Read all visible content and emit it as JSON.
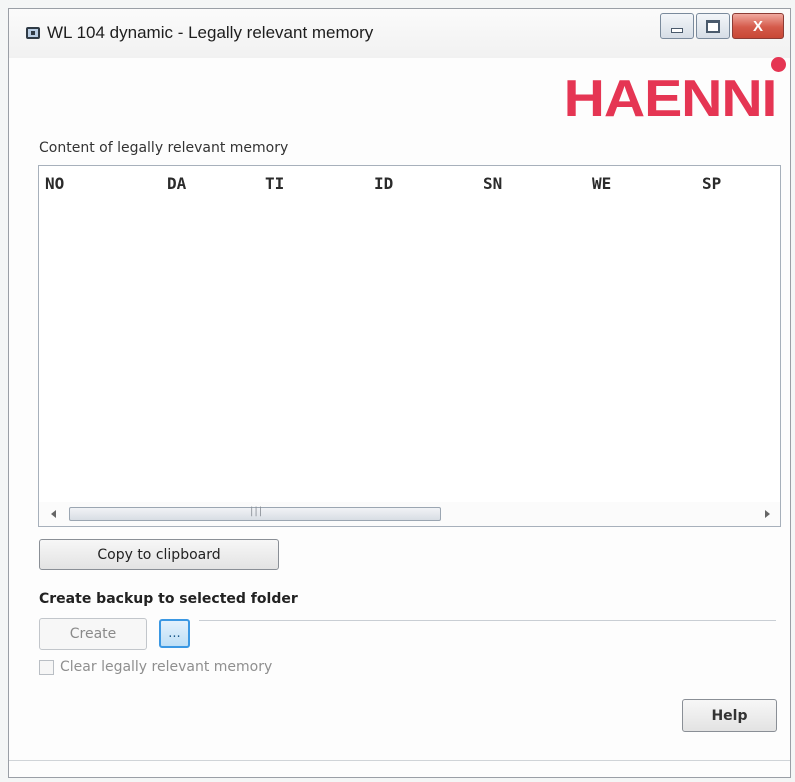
{
  "window": {
    "title": "WL 104 dynamic - Legally relevant memory",
    "close_glyph": "X",
    "icons": [
      "app-icon",
      "minimize-icon",
      "maximize-icon",
      "close-icon"
    ]
  },
  "logo": {
    "text": "HAENNI",
    "color": "#e53553"
  },
  "memory": {
    "label": "Content of legally relevant memory",
    "columns": [
      "NO",
      "DA",
      "TI",
      "ID",
      "SN",
      "WE",
      "SP"
    ],
    "rows": [],
    "scroll_grip": "|||"
  },
  "actions": {
    "copy_label": "Copy to clipboard",
    "backup_label": "Create backup to selected folder",
    "create_label": "Create",
    "browse_label": "...",
    "clear_label": "Clear legally relevant memory",
    "clear_checked": false,
    "help_label": "Help"
  },
  "colors": {
    "accent": "#3b98e3",
    "close_button": "#d45a4a"
  }
}
